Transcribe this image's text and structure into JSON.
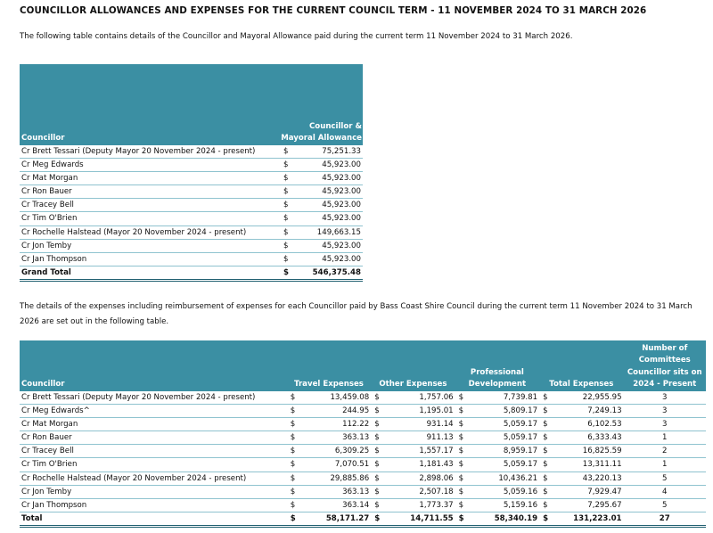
{
  "title": "COUNCILLOR ALLOWANCES AND EXPENSES FOR THE CURRENT COUNCIL TERM - 11 NOVEMBER 2024 TO 31 MARCH 2026",
  "intro1": "The following table contains details of the Councillor and Mayoral Allowance paid during the current term 11 November 2024 to 31 March 2026.",
  "intro2": "The details of the expenses including reimbursement of expenses for each Councillor paid by Bass Coast Shire Council during the current term 11 November 2024 to 31 March 2026 are set out in the following table.",
  "currency": "$",
  "allowance_table": {
    "headers": {
      "councillor": "Councillor",
      "allowance": "Councillor & Mayoral Allowance"
    },
    "rows": [
      {
        "name": "Cr Brett Tessari (Deputy Mayor 20 November 2024 - present)",
        "allowance": "75,251.33"
      },
      {
        "name": "Cr Meg Edwards",
        "allowance": "45,923.00"
      },
      {
        "name": "Cr Mat Morgan",
        "allowance": "45,923.00"
      },
      {
        "name": "Cr Ron Bauer",
        "allowance": "45,923.00"
      },
      {
        "name": "Cr Tracey Bell",
        "allowance": "45,923.00"
      },
      {
        "name": "Cr Tim O'Brien",
        "allowance": "45,923.00"
      },
      {
        "name": "Cr Rochelle Halstead (Mayor 20 November 2024 - present)",
        "allowance": "149,663.15"
      },
      {
        "name": "Cr Jon Temby",
        "allowance": "45,923.00"
      },
      {
        "name": "Cr Jan Thompson",
        "allowance": "45,923.00"
      }
    ],
    "total": {
      "label": "Grand Total",
      "allowance": "546,375.48"
    }
  },
  "expenses_table": {
    "headers": {
      "councillor": "Councillor",
      "travel": "Travel Expenses",
      "other": "Other Expenses",
      "professional": "Professional Development",
      "total": "Total Expenses",
      "committees": "Number of Committees Councillor sits on 2024 - Present"
    },
    "rows": [
      {
        "name": "Cr Brett Tessari (Deputy Mayor 20 November 2024 - present)",
        "travel": "13,459.08",
        "other": "1,757.06",
        "professional": "7,739.81",
        "total": "22,955.95",
        "committees": "3"
      },
      {
        "name": "Cr Meg Edwards^",
        "travel": "244.95",
        "other": "1,195.01",
        "professional": "5,809.17",
        "total": "7,249.13",
        "committees": "3"
      },
      {
        "name": "Cr Mat Morgan",
        "travel": "112.22",
        "other": "931.14",
        "professional": "5,059.17",
        "total": "6,102.53",
        "committees": "3"
      },
      {
        "name": "Cr Ron Bauer",
        "travel": "363.13",
        "other": "911.13",
        "professional": "5,059.17",
        "total": "6,333.43",
        "committees": "1"
      },
      {
        "name": "Cr Tracey Bell",
        "travel": "6,309.25",
        "other": "1,557.17",
        "professional": "8,959.17",
        "total": "16,825.59",
        "committees": "2"
      },
      {
        "name": "Cr Tim O'Brien",
        "travel": "7,070.51",
        "other": "1,181.43",
        "professional": "5,059.17",
        "total": "13,311.11",
        "committees": "1"
      },
      {
        "name": "Cr Rochelle Halstead (Mayor 20 November 2024 - present)",
        "travel": "29,885.86",
        "other": "2,898.06",
        "professional": "10,436.21",
        "total": "43,220.13",
        "committees": "5"
      },
      {
        "name": "Cr Jon Temby",
        "travel": "363.13",
        "other": "2,507.18",
        "professional": "5,059.16",
        "total": "7,929.47",
        "committees": "4"
      },
      {
        "name": "Cr Jan Thompson",
        "travel": "363.14",
        "other": "1,773.37",
        "professional": "5,159.16",
        "total": "7,295.67",
        "committees": "5"
      }
    ],
    "total": {
      "label": "Total",
      "travel": "58,171.27",
      "other": "14,711.55",
      "professional": "58,340.19",
      "total": "131,223.01",
      "committees": "27"
    }
  }
}
